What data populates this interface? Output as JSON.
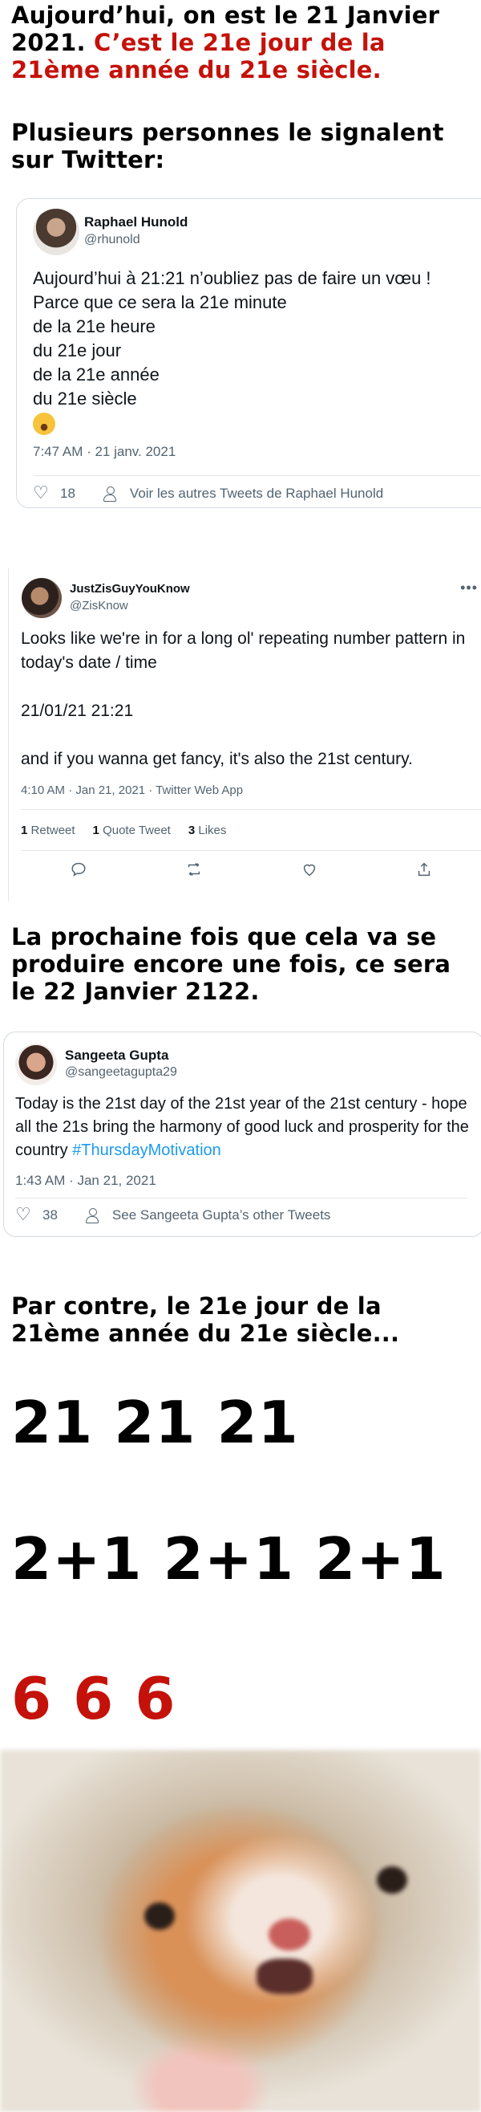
{
  "headings": {
    "intro_black": "Aujourd’hui, on est le 21 Janvier 2021.",
    "intro_red": "C’est le 21e jour de la 21ème année du 21e siècle.",
    "twitter": "Plusieurs personnes le signalent sur Twitter:",
    "next": "La prochaine fois que cela va se produire encore une fois, ce sera le 22 Janvier 2122.",
    "however": "Par contre, le 21e jour de la 21ème année du 21e siècle..."
  },
  "tweet1": {
    "name": "Raphael Hunold",
    "handle": "@rhunold",
    "text": "Aujourd’hui à 21:21 n’oubliez pas de faire un vœu !\nParce que ce sera la 21e minute\nde la 21e heure\ndu 21e jour\nde la 21e année\ndu 21e siècle",
    "emoji_icon": "astonished-face-emoji",
    "time": "7:47 AM · 21 janv. 2021",
    "likes": "18",
    "more_link": "Voir les autres Tweets de Raphael Hunold"
  },
  "tweet2": {
    "name": "JustZisGuyYouKnow",
    "handle": "@ZisKnow",
    "more": "•••",
    "text": "Looks like we're in for a long ol' repeating number pattern in today's date / time\n\n21/01/21 21:21\n\nand if you wanna get fancy, it's also the 21st century.",
    "time": "4:10 AM · Jan 21, 2021 · Twitter Web App",
    "retweets_count": "1",
    "retweets_label": "Retweet",
    "quotes_count": "1",
    "quotes_label": "Quote Tweet",
    "likes_count": "3",
    "likes_label": "Likes"
  },
  "tweet3": {
    "name": "Sangeeta Gupta",
    "handle": "@sangeetagupta29",
    "text": "Today is the 21st day of the 21st year of the 21st century  - hope all the 21s bring the harmony of good luck and prosperity for the country ",
    "hashtag": "#ThursdayMotivation",
    "time": "1:43 AM · Jan 21, 2021",
    "likes": "38",
    "more_link": "See Sangeeta Gupta’s other Tweets"
  },
  "numbers": {
    "line1": "21 21 21",
    "line2": "2+1 2+1 2+1",
    "line3": "6 6 6"
  },
  "colors": {
    "red": "#c4120a",
    "link_blue": "#1d9bf0"
  }
}
